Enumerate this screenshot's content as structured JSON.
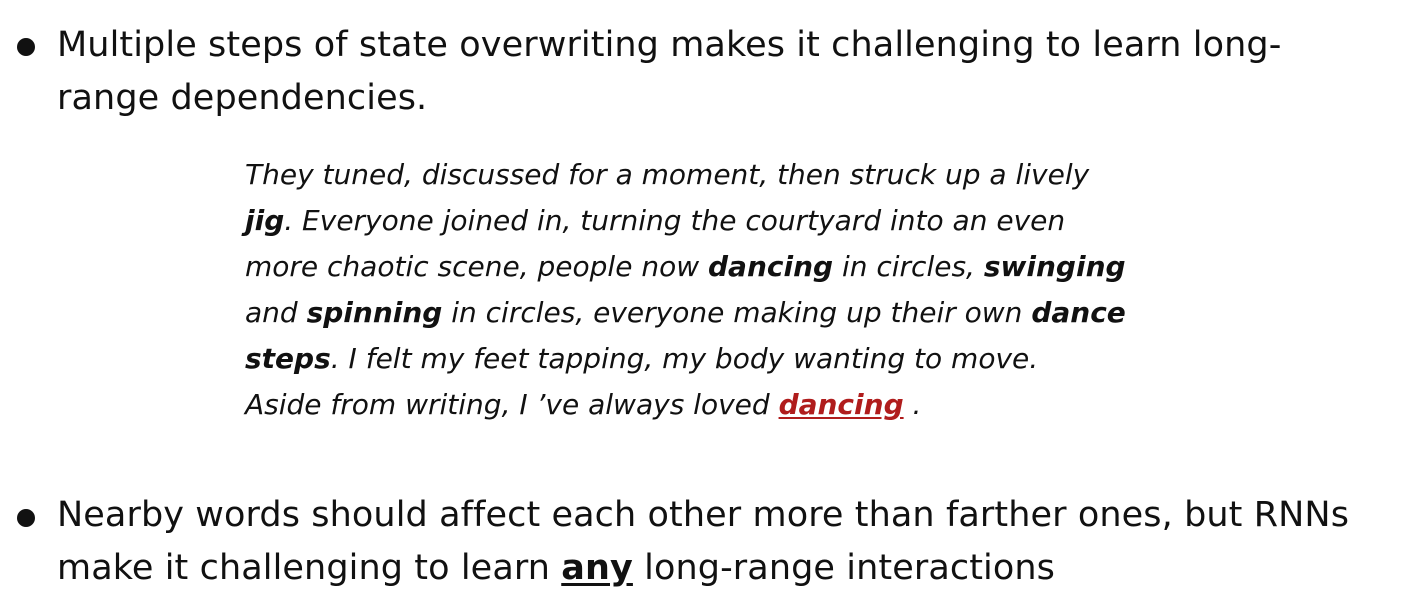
{
  "bullets": [
    {
      "text": "Multiple steps of state overwriting makes it challenging to learn long-range dependencies.",
      "line1": "Multiple steps of state overwriting makes it challenging to learn long-",
      "line2": "range dependencies."
    },
    {
      "line1": "Nearby words should affect each other more than farther ones, but RNNs",
      "line2_prefix": "make it challenging to learn ",
      "line2_emphasis": "any",
      "line2_suffix": " long-range interactions"
    }
  ],
  "quote": {
    "lines": [
      [
        {
          "t": "They tuned, discussed for a moment, then struck up a lively"
        }
      ],
      [
        {
          "t": "jig",
          "b": true
        },
        {
          "t": ". Everyone joined in, turning the courtyard into an even"
        }
      ],
      [
        {
          "t": "more chaotic scene, people now "
        },
        {
          "t": "dancing",
          "b": true
        },
        {
          "t": " in circles, "
        },
        {
          "t": "swinging",
          "b": true
        }
      ],
      [
        {
          "t": "and "
        },
        {
          "t": "spinning",
          "b": true
        },
        {
          "t": " in circles, everyone making up their own "
        },
        {
          "t": "dance",
          "b": true
        }
      ],
      [
        {
          "t": "steps",
          "b": true
        },
        {
          "t": ". I felt my feet tapping, my body wanting to move."
        }
      ],
      [
        {
          "t": "Aside from writing, I ’ve always loved "
        },
        {
          "t": "dancing",
          "target": true
        },
        {
          "t": " ."
        }
      ]
    ]
  },
  "colors": {
    "text": "#111111",
    "target_word": "#b01c1c",
    "background": "#ffffff"
  }
}
